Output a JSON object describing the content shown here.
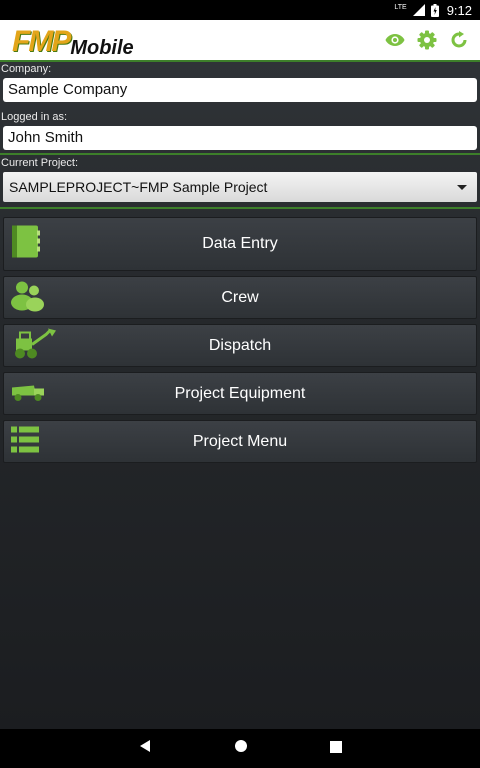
{
  "status": {
    "network": "LTE",
    "time": "9:12"
  },
  "app": {
    "logo_main": "FMP",
    "logo_sub": "Mobile"
  },
  "form": {
    "company_label": "Company:",
    "company_value": "Sample Company",
    "user_label": "Logged in as:",
    "user_value": "John Smith",
    "project_label": "Current Project:",
    "project_value": "SAMPLEPROJECT~FMP Sample Project"
  },
  "menu": [
    {
      "label": "Data Entry",
      "icon": "notebook-icon"
    },
    {
      "label": "Crew",
      "icon": "people-icon"
    },
    {
      "label": "Dispatch",
      "icon": "loader-icon"
    },
    {
      "label": "Project Equipment",
      "icon": "truck-icon"
    },
    {
      "label": "Project Menu",
      "icon": "list-icon"
    }
  ],
  "colors": {
    "accent": "#7dc242",
    "logo_orange": "#e3a51a",
    "separator": "#3d7f2a"
  }
}
